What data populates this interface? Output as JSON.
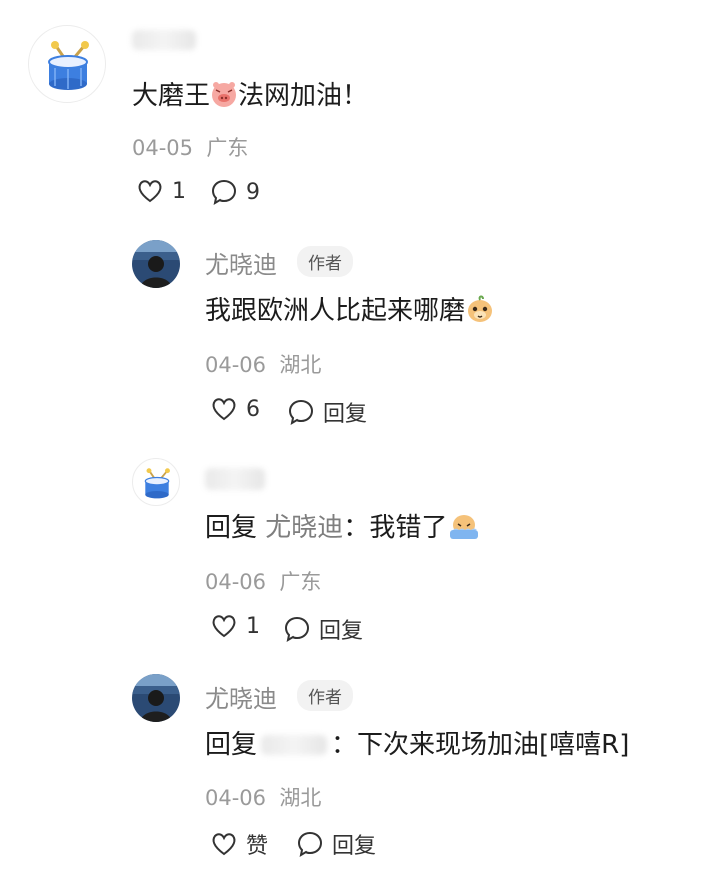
{
  "comments": [
    {
      "avatar_icon": "drum-icon",
      "text_before": "大磨王",
      "emoji_inline": "pig-face-emoji",
      "text_after": "法网加油！",
      "date": "04-05",
      "location": "广东",
      "likes": "1",
      "replies": "9"
    }
  ],
  "replies": [
    {
      "author": "尤晓迪",
      "badge": "作者",
      "text": "我跟欧洲人比起来哪磨",
      "emoji_inline": "cute-face-emoji",
      "date": "04-06",
      "location": "湖北",
      "likes": "6",
      "reply_label": "回复"
    },
    {
      "avatar_icon": "drum-icon",
      "reply_prefix": "回复",
      "reply_to": "尤晓迪",
      "separator": "：",
      "text": "我错了",
      "emoji_inline": "crying-emoji",
      "date": "04-06",
      "location": "广东",
      "likes": "1",
      "reply_label": "回复"
    },
    {
      "author": "尤晓迪",
      "badge": "作者",
      "reply_prefix": "回复",
      "separator": "：",
      "text": "下次来现场加油[嘻嘻R]",
      "date": "04-06",
      "location": "湖北",
      "like_label": "赞",
      "reply_label": "回复"
    }
  ],
  "colors": {
    "drum_blue": "#3d7fe0",
    "drum_stick": "#f2c94c",
    "text": "#1c1c1c",
    "meta": "#9a9a9a"
  }
}
